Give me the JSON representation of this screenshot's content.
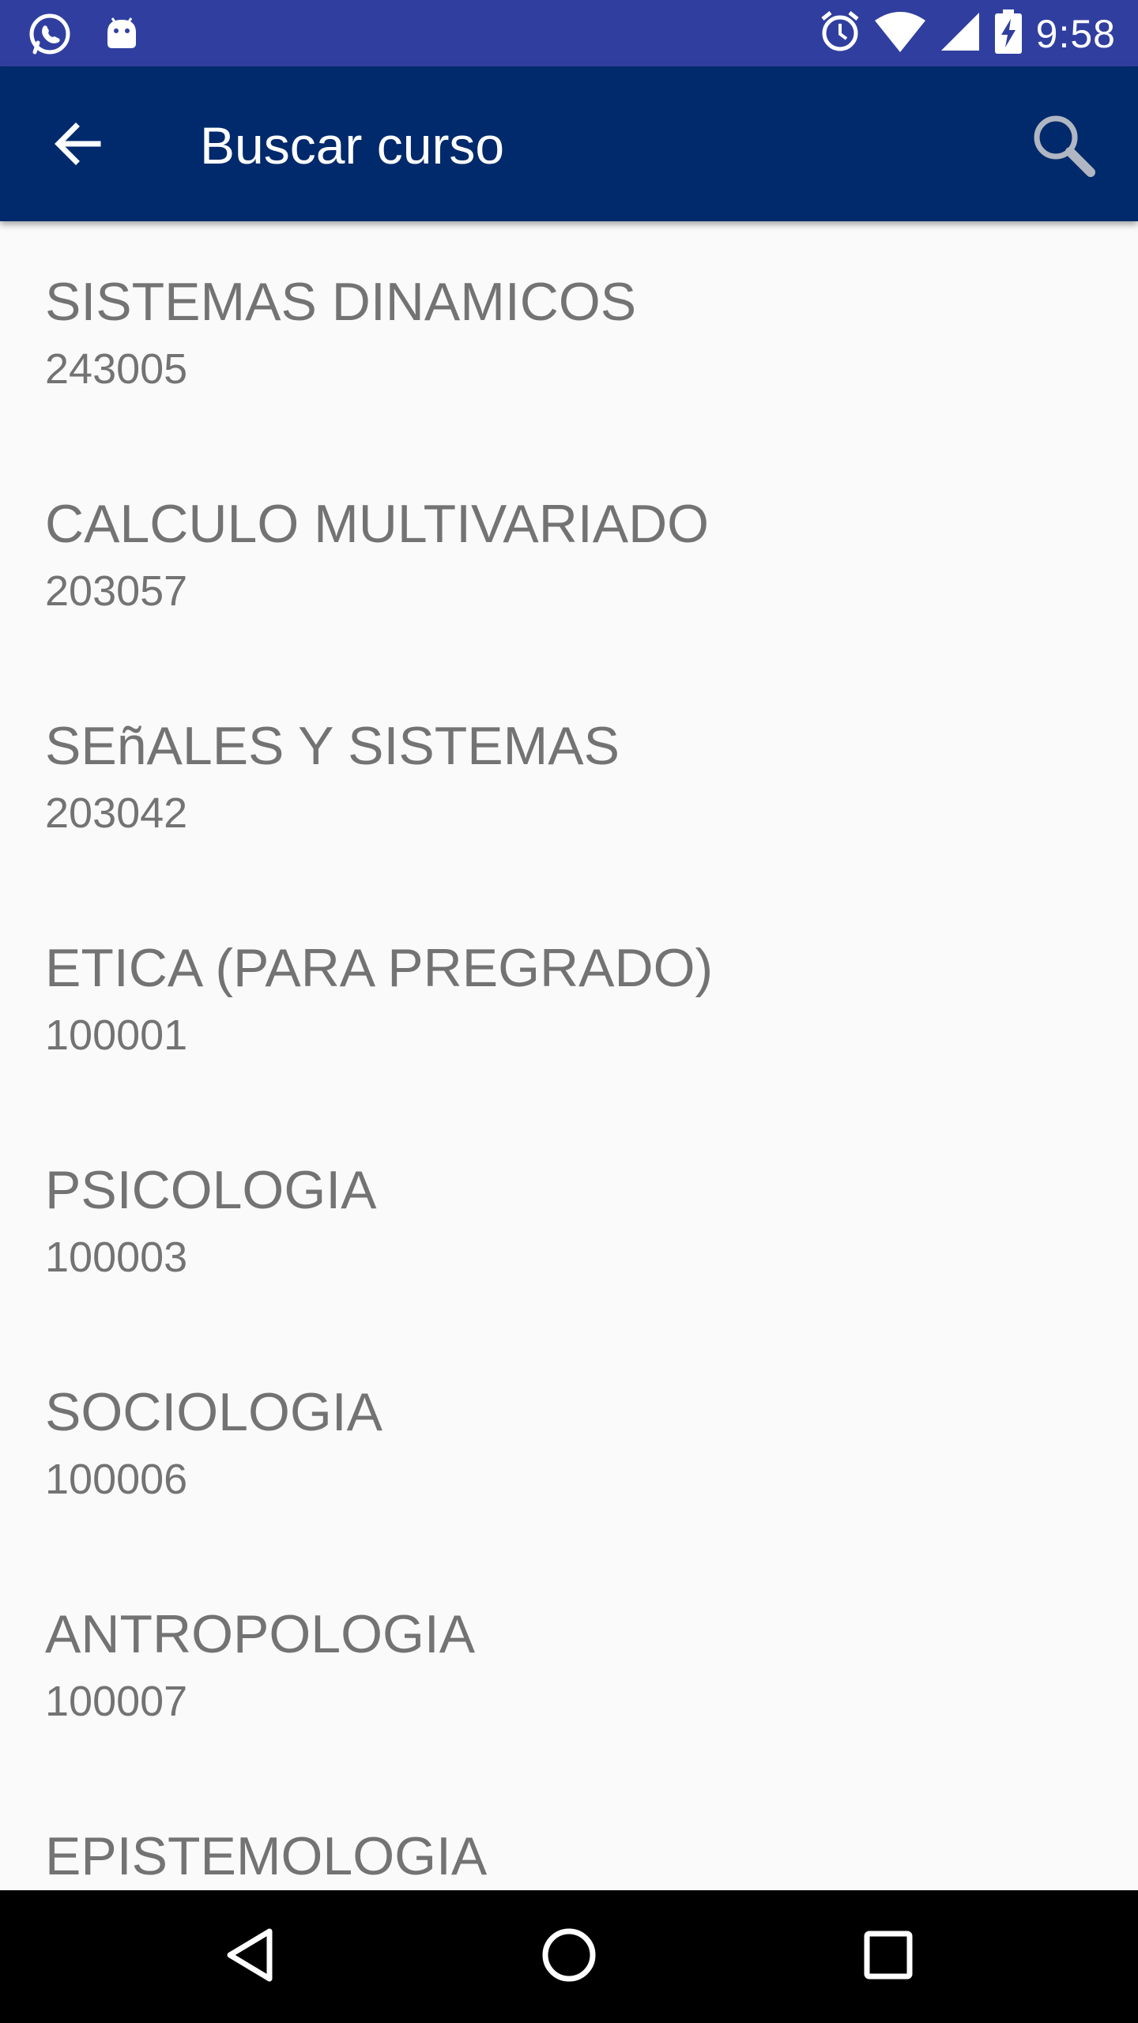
{
  "status_bar": {
    "time": "9:58",
    "icons": [
      "whatsapp-icon",
      "android-icon",
      "alarm-icon",
      "wifi-icon",
      "signal-icon",
      "battery-charging-icon"
    ]
  },
  "app_bar": {
    "title": "Buscar curso",
    "back_icon": "arrow-back-icon",
    "search_icon": "search-icon",
    "background": "#002a6b"
  },
  "courses": [
    {
      "name": "SISTEMAS DINAMICOS",
      "code": "243005"
    },
    {
      "name": "CALCULO MULTIVARIADO",
      "code": "203057"
    },
    {
      "name": "SEñALES Y SISTEMAS",
      "code": "203042"
    },
    {
      "name": "ETICA (PARA PREGRADO)",
      "code": "100001"
    },
    {
      "name": "PSICOLOGIA",
      "code": "100003"
    },
    {
      "name": "SOCIOLOGIA",
      "code": "100006"
    },
    {
      "name": "ANTROPOLOGIA",
      "code": "100007"
    },
    {
      "name": "EPISTEMOLOGIA",
      "code": ""
    }
  ],
  "nav_bar": {
    "icons": [
      "back-triangle-icon",
      "home-circle-icon",
      "recents-square-icon"
    ]
  }
}
